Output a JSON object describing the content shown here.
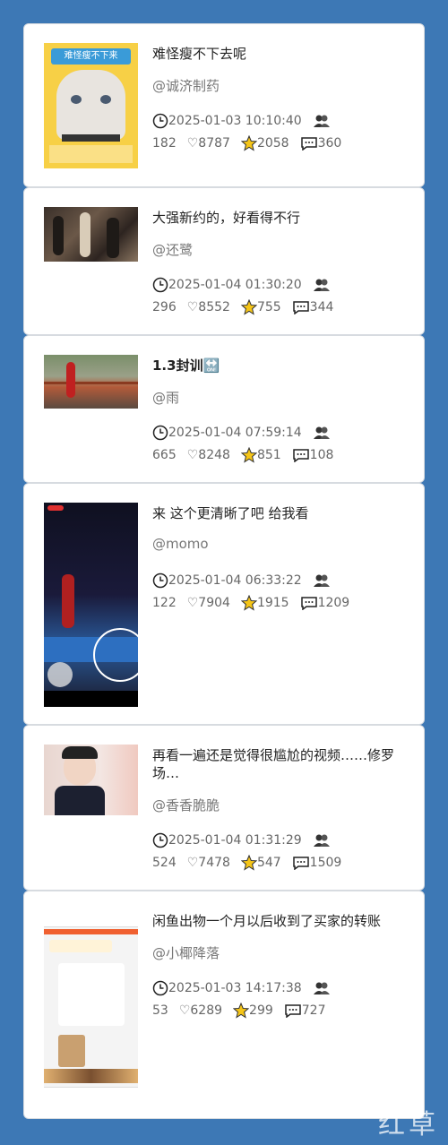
{
  "posts": [
    {
      "title": "难怪瘦不下去呢",
      "author": "@诚济制药",
      "time": "2025-01-03 10:10:40",
      "views": "182",
      "likes": "8787",
      "stars": "2058",
      "comments": "360",
      "thumb_text": "难怪瘦不下来"
    },
    {
      "title": "大强新约的，好看得不行",
      "author": "@还鹭",
      "time": "2025-01-04 01:30:20",
      "views": "296",
      "likes": "8552",
      "stars": "755",
      "comments": "344"
    },
    {
      "title": "1.3封训🔛",
      "author": "@雨",
      "time": "2025-01-04 07:59:14",
      "views": "665",
      "likes": "8248",
      "stars": "851",
      "comments": "108"
    },
    {
      "title": "来 这个更清晰了吧 给我看",
      "author": "@momo",
      "time": "2025-01-04 06:33:22",
      "views": "122",
      "likes": "7904",
      "stars": "1915",
      "comments": "1209"
    },
    {
      "title": "再看一遍还是觉得很尴尬的视频……修罗场…",
      "author": "@香香脆脆",
      "time": "2025-01-04 01:31:29",
      "views": "524",
      "likes": "7478",
      "stars": "547",
      "comments": "1509"
    },
    {
      "title": "闲鱼出物一个月以后收到了买家的转账",
      "author": "@小椰降落",
      "time": "2025-01-03 14:17:38",
      "views": "53",
      "likes": "6289",
      "stars": "299",
      "comments": "727"
    }
  ],
  "watermark": "红草",
  "colors": {
    "background": "#3d78b5",
    "card": "#ffffff",
    "star": "#f5c518"
  }
}
